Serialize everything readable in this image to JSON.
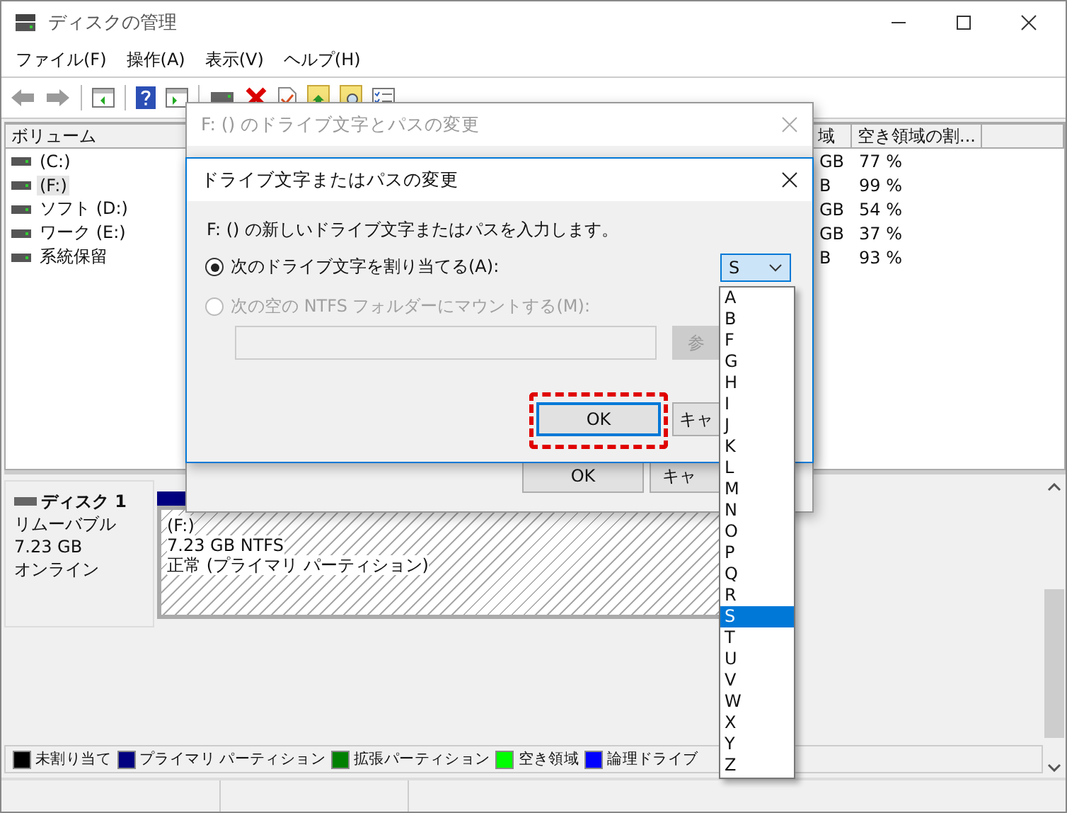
{
  "window": {
    "title": "ディスクの管理"
  },
  "menu": [
    "ファイル(F)",
    "操作(A)",
    "表示(V)",
    "ヘルプ(H)"
  ],
  "volume_list": {
    "columns": [
      "ボリューム",
      "域",
      "空き領域の割..."
    ],
    "rows": [
      {
        "volume": "(C:)",
        "column_2": "GB",
        "free_percent": "77 %",
        "selected": false
      },
      {
        "volume": "(F:)",
        "column_2": "B",
        "free_percent": "99 %",
        "selected": true
      },
      {
        "volume": "ソフト (D:)",
        "column_2": "GB",
        "free_percent": "54 %",
        "selected": false
      },
      {
        "volume": "ワーク (E:)",
        "column_2": "GB",
        "free_percent": "37 %",
        "selected": false
      },
      {
        "volume": "系統保留",
        "column_2": "B",
        "free_percent": "93 %",
        "selected": false
      }
    ]
  },
  "disk": {
    "name": "ディスク 1",
    "type": "リムーバブル",
    "size": "7.23 GB",
    "status": "オンライン"
  },
  "partition": {
    "label": "(F:)",
    "size": "7.23 GB NTFS",
    "status": "正常 (プライマリ パーティション)"
  },
  "legend": [
    {
      "label": "未割り当て",
      "color": "#000000"
    },
    {
      "label": "プライマリ パーティション",
      "color": "#000080"
    },
    {
      "label": "拡張パーティション",
      "color": "#008000"
    },
    {
      "label": "空き領域",
      "color": "#00ff00"
    },
    {
      "label": "論理ドライブ",
      "color": "#0000ff"
    }
  ],
  "outer_dialog": {
    "title": "F: () のドライブ文字とパスの変更",
    "buttons": [
      "OK",
      "キャ"
    ]
  },
  "inner_dialog": {
    "title": "ドライブ文字またはパスの変更",
    "prompt": "F: () の新しいドライブ文字またはパスを入力します。",
    "options": [
      {
        "label": "次のドライブ文字を割り当てる(A):",
        "selected": true,
        "disabled": false
      },
      {
        "label": "次の空の NTFS フォルダーにマウントする(M):",
        "selected": false,
        "disabled": true
      }
    ],
    "drive_letter": "S",
    "browse_button": {
      "label": "参",
      "disabled": true
    },
    "buttons": [
      {
        "label": "OK",
        "focused": true,
        "highlighted": true
      },
      {
        "label": "キャ",
        "focused": false,
        "highlighted": false
      }
    ]
  },
  "dropdown": {
    "items": [
      {
        "label": "A",
        "selected": false
      },
      {
        "label": "B",
        "selected": false
      },
      {
        "label": "F",
        "selected": false
      },
      {
        "label": "G",
        "selected": false
      },
      {
        "label": "H",
        "selected": false
      },
      {
        "label": "I",
        "selected": false
      },
      {
        "label": "J",
        "selected": false
      },
      {
        "label": "K",
        "selected": false
      },
      {
        "label": "L",
        "selected": false
      },
      {
        "label": "M",
        "selected": false
      },
      {
        "label": "N",
        "selected": false
      },
      {
        "label": "O",
        "selected": false
      },
      {
        "label": "P",
        "selected": false
      },
      {
        "label": "Q",
        "selected": false
      },
      {
        "label": "R",
        "selected": false
      },
      {
        "label": "S",
        "selected": true
      },
      {
        "label": "T",
        "selected": false
      },
      {
        "label": "U",
        "selected": false
      },
      {
        "label": "V",
        "selected": false
      },
      {
        "label": "W",
        "selected": false
      },
      {
        "label": "X",
        "selected": false
      },
      {
        "label": "Y",
        "selected": false
      },
      {
        "label": "Z",
        "selected": false
      }
    ]
  }
}
